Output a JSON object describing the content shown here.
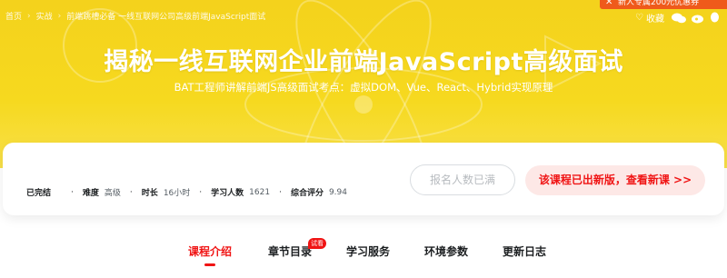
{
  "breadcrumb": {
    "items": [
      "首页",
      "实战",
      "前端跳槽必备 一线互联网公司高级前端JavaScript面试"
    ]
  },
  "promo": {
    "label": "新人专属200元优惠券"
  },
  "toolbar": {
    "favorite_label": "收藏"
  },
  "hero": {
    "title": "揭秘一线互联网企业前端JavaScript高级面试",
    "subtitle": "BAT工程师讲解前端JS高级面试考点：虚拟DOM、Vue、React、Hybrid实现原理"
  },
  "meta": {
    "status": "已完结",
    "difficulty_label": "难度",
    "difficulty_value": "高级",
    "duration_label": "时长",
    "duration_value": "16小时",
    "learners_label": "学习人数",
    "learners_value": "1621",
    "rating_label": "综合评分",
    "rating_value": "9.94"
  },
  "actions": {
    "full_label": "报名人数已满",
    "new_version_label": "该课程已出新版，查看新课 >>"
  },
  "tabs": [
    {
      "label": "课程介绍"
    },
    {
      "label": "章节目录",
      "badge": "试看"
    },
    {
      "label": "学习服务"
    },
    {
      "label": "环境参数"
    },
    {
      "label": "更新日志"
    }
  ],
  "colors": {
    "hero": "#f6d91f",
    "accent": "#f01414",
    "promo": "#ef5a1b"
  }
}
